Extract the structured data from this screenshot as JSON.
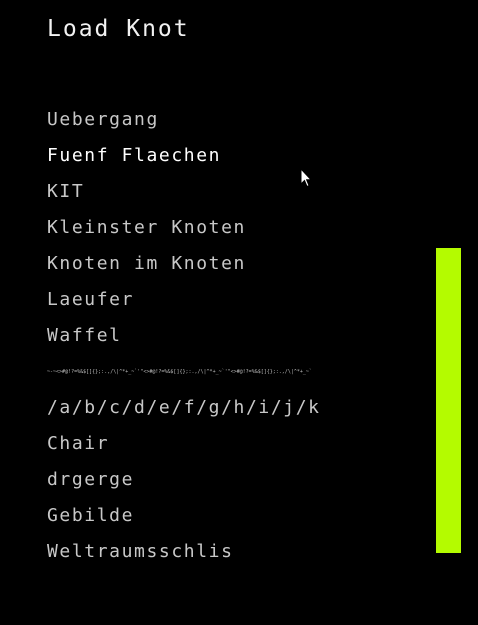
{
  "title": "Load Knot",
  "knots": [
    "Uebergang",
    "Fuenf Flaechen",
    "KIT",
    "Kleinster Knoten",
    "Knoten im Knoten",
    "Laeufer",
    "Waffel",
    "~-~<>#@!?=%&$[]{};:.,/\\|^*+_~`'\"<>#@!?=%&$[]{};:.,/\\|^*+_~`'\"<>#@!?=%&$[]{};:.,/\\|^*+_~`",
    "/a/b/c/d/e/f/g/h/i/j/k",
    "Chair",
    "drgerge",
    "Gebilde",
    "Weltraumsschlis"
  ],
  "hovered_index": 1,
  "colors": {
    "background": "#000000",
    "text": "#c8c8c8",
    "hover_text": "#ffffff",
    "scrollbar": "#b4fb00"
  }
}
